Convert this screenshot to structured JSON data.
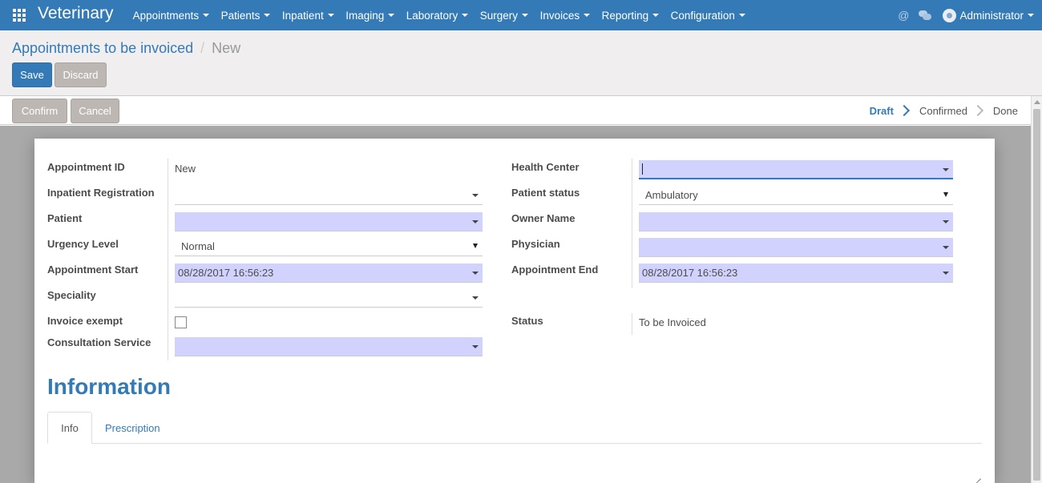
{
  "app": {
    "brand": "Veterinary",
    "menu": [
      "Appointments",
      "Patients",
      "Inpatient",
      "Imaging",
      "Laboratory",
      "Surgery",
      "Invoices",
      "Reporting",
      "Configuration"
    ],
    "user": "Administrator",
    "at_symbol": "@",
    "primary_color": "#337ab7"
  },
  "breadcrumb": {
    "parent": "Appointments to be invoiced",
    "separator": "/",
    "current": "New"
  },
  "buttons": {
    "save": "Save",
    "discard": "Discard",
    "confirm": "Confirm",
    "cancel": "Cancel"
  },
  "status": {
    "steps": [
      "Draft",
      "Confirmed",
      "Done"
    ],
    "active": "Draft"
  },
  "form": {
    "left": {
      "appointment_id": {
        "label": "Appointment ID",
        "value": "New"
      },
      "inpatient_registration": {
        "label": "Inpatient Registration",
        "value": ""
      },
      "patient": {
        "label": "Patient",
        "value": ""
      },
      "urgency_level": {
        "label": "Urgency Level",
        "value": "Normal"
      },
      "appointment_start": {
        "label": "Appointment Start",
        "value": "08/28/2017 16:56:23"
      },
      "speciality": {
        "label": "Speciality",
        "value": ""
      },
      "invoice_exempt": {
        "label": "Invoice exempt",
        "checked": false
      },
      "consultation_service": {
        "label": "Consultation Service",
        "value": ""
      }
    },
    "right": {
      "health_center": {
        "label": "Health Center",
        "value": ""
      },
      "patient_status": {
        "label": "Patient status",
        "value": "Ambulatory"
      },
      "owner_name": {
        "label": "Owner Name",
        "value": ""
      },
      "physician": {
        "label": "Physician",
        "value": ""
      },
      "appointment_end": {
        "label": "Appointment End",
        "value": "08/28/2017 16:56:23"
      },
      "status": {
        "label": "Status",
        "value": "To be Invoiced"
      }
    }
  },
  "information": {
    "title": "Information",
    "tabs": [
      "Info",
      "Prescription"
    ],
    "active_tab": "Info"
  }
}
